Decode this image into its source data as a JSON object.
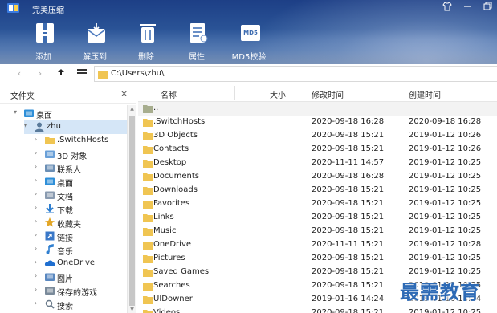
{
  "app": {
    "title": "完美压缩"
  },
  "toolbar": {
    "items": [
      {
        "label": "添加",
        "icon": "add-archive-icon"
      },
      {
        "label": "解压到",
        "icon": "extract-icon"
      },
      {
        "label": "删除",
        "icon": "delete-icon"
      },
      {
        "label": "属性",
        "icon": "properties-icon"
      },
      {
        "label": "MD5校验",
        "icon": "md5-icon"
      }
    ],
    "md5_badge": "MD5"
  },
  "address": {
    "path": "C:\\Users\\zhu\\"
  },
  "left_panel": {
    "title": "文件夹",
    "close_glyph": "×",
    "tree": [
      {
        "label": "桌面",
        "icon": "desktop-folder-icon",
        "level": 0,
        "expander": "▾"
      },
      {
        "label": "zhu",
        "icon": "user-icon",
        "level": 1,
        "expander": "▾",
        "selected": true
      },
      {
        "label": ".SwitchHosts",
        "icon": "folder-icon",
        "level": 2,
        "expander": "›"
      },
      {
        "label": "3D 对象",
        "icon": "3d-objects-icon",
        "level": 2,
        "expander": "›"
      },
      {
        "label": "联系人",
        "icon": "contacts-icon",
        "level": 2,
        "expander": "›"
      },
      {
        "label": "桌面",
        "icon": "desktop-folder-icon",
        "level": 2,
        "expander": "›"
      },
      {
        "label": "文档",
        "icon": "documents-icon",
        "level": 2,
        "expander": "›"
      },
      {
        "label": "下载",
        "icon": "download-icon",
        "level": 2,
        "expander": "›"
      },
      {
        "label": "收藏夹",
        "icon": "star-icon",
        "level": 2,
        "expander": "›"
      },
      {
        "label": "链接",
        "icon": "link-icon",
        "level": 2,
        "expander": "›"
      },
      {
        "label": "音乐",
        "icon": "music-icon",
        "level": 2,
        "expander": "›"
      },
      {
        "label": "OneDrive",
        "icon": "cloud-icon",
        "level": 2,
        "expander": "›"
      },
      {
        "label": "图片",
        "icon": "pictures-icon",
        "level": 2,
        "expander": "›"
      },
      {
        "label": "保存的游戏",
        "icon": "saved-games-icon",
        "level": 2,
        "expander": "›"
      },
      {
        "label": "搜索",
        "icon": "search-icon",
        "level": 2,
        "expander": "›"
      }
    ]
  },
  "file_list": {
    "columns": {
      "name": "名称",
      "size": "大小",
      "modified": "修改时间",
      "created": "创建时间"
    },
    "parent": "..",
    "rows": [
      {
        "name": ".SwitchHosts",
        "modified": "2020-09-18 16:28",
        "created": "2020-09-18 16:28"
      },
      {
        "name": "3D Objects",
        "modified": "2020-09-18 15:21",
        "created": "2019-01-12 10:26"
      },
      {
        "name": "Contacts",
        "modified": "2020-09-18 15:21",
        "created": "2019-01-12 10:26"
      },
      {
        "name": "Desktop",
        "modified": "2020-11-11 14:57",
        "created": "2019-01-12 10:25"
      },
      {
        "name": "Documents",
        "modified": "2020-09-18 16:28",
        "created": "2019-01-12 10:25"
      },
      {
        "name": "Downloads",
        "modified": "2020-09-18 15:21",
        "created": "2019-01-12 10:25"
      },
      {
        "name": "Favorites",
        "modified": "2020-09-18 15:21",
        "created": "2019-01-12 10:25"
      },
      {
        "name": "Links",
        "modified": "2020-09-18 15:21",
        "created": "2019-01-12 10:25"
      },
      {
        "name": "Music",
        "modified": "2020-09-18 15:21",
        "created": "2019-01-12 10:25"
      },
      {
        "name": "OneDrive",
        "modified": "2020-11-11 15:21",
        "created": "2019-01-12 10:28"
      },
      {
        "name": "Pictures",
        "modified": "2020-09-18 15:21",
        "created": "2019-01-12 10:25"
      },
      {
        "name": "Saved Games",
        "modified": "2020-09-18 15:21",
        "created": "2019-01-12 10:25"
      },
      {
        "name": "Searches",
        "modified": "2020-09-18 15:21",
        "created": "2019-01-12 10:25"
      },
      {
        "name": "UIDowner",
        "modified": "2019-01-16 14:24",
        "created": "2019-01-16 14:24"
      },
      {
        "name": "Videos",
        "modified": "2020-09-18 15:21",
        "created": "2019-01-12 10:25"
      }
    ]
  },
  "watermark": "最需教育",
  "colors": {
    "folder": "#f0c552",
    "accent": "#2d6ab5",
    "selection": "#d5e6f7"
  }
}
